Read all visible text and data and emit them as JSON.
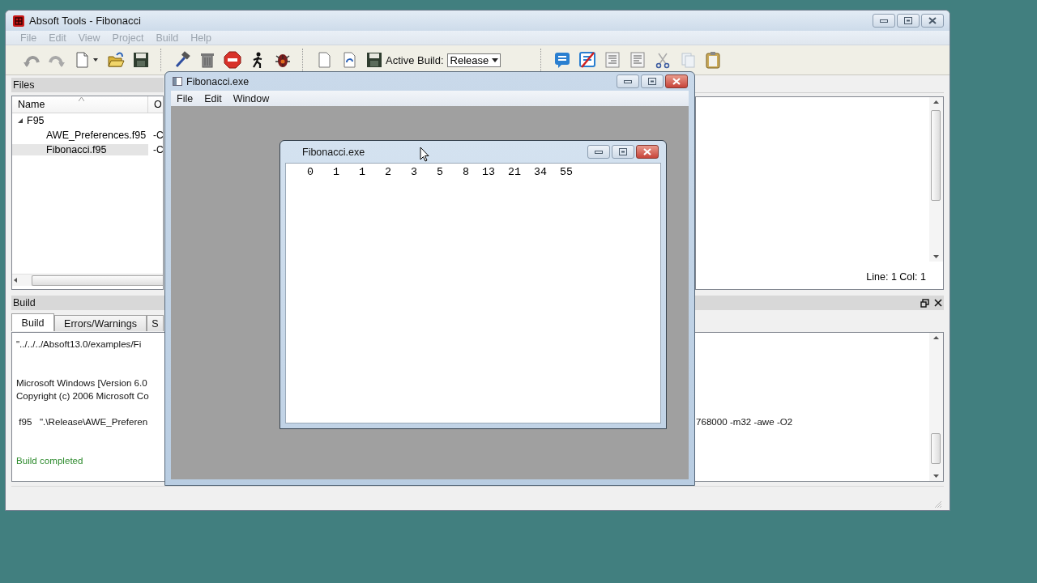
{
  "window": {
    "title": "Absoft Tools - Fibonacci"
  },
  "menu": [
    "File",
    "Edit",
    "View",
    "Project",
    "Build",
    "Help"
  ],
  "toolbar": {
    "active_build_label": "Active Build:",
    "active_build": "Release"
  },
  "files_panel": {
    "title": "Files",
    "columns": [
      "Name",
      "O"
    ],
    "tree": [
      {
        "name": "F95",
        "expanded": true,
        "children": [
          {
            "name": "AWE_Preferences.f95",
            "column_2": "-C",
            "selected": false
          },
          {
            "name": "Fibonacci.f95",
            "column_2": "-C",
            "selected": true
          }
        ]
      }
    ]
  },
  "editor": {
    "status": "Line: 1 Col: 1"
  },
  "build_panel": {
    "title": "Build",
    "tabs": [
      {
        "label": "Build",
        "selected": true
      },
      {
        "label": "Errors/Warnings",
        "selected": false
      },
      {
        "label": "S",
        "selected": false
      }
    ],
    "output": [
      {
        "kind": "text",
        "left": "\"../../../Absoft13.0/examples/Fi"
      },
      {
        "kind": "blank"
      },
      {
        "kind": "blank"
      },
      {
        "kind": "text",
        "left": "Microsoft Windows [Version 6.0"
      },
      {
        "kind": "text",
        "left": "Copyright (c) 2006 Microsoft Co"
      },
      {
        "kind": "blank"
      },
      {
        "kind": "text",
        "left": " f95   \".\\Release\\AWE_Preferen",
        "right": "768000 -m32 -awe -O2"
      },
      {
        "kind": "blank"
      },
      {
        "kind": "blank"
      },
      {
        "kind": "success",
        "left": "Build completed"
      }
    ]
  },
  "exe_window": {
    "title": "Fibonacci.exe",
    "menu": [
      "File",
      "Edit",
      "Window"
    ],
    "child": {
      "title": "Fibonacci.exe",
      "output": "   0   1   1   2   3   5   8  13  21  34  55"
    }
  }
}
